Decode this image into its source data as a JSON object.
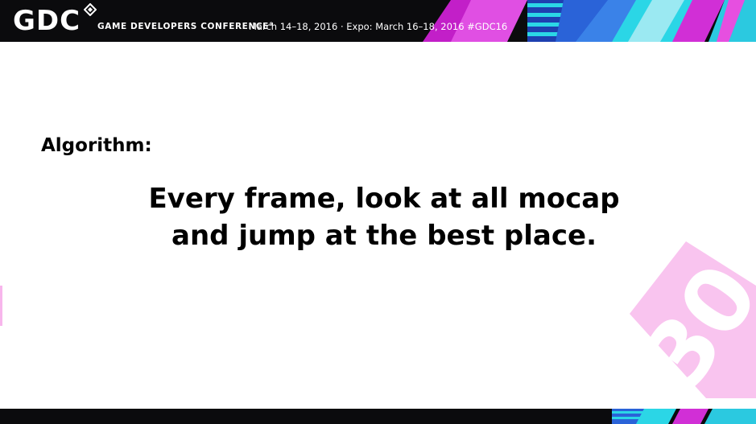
{
  "header": {
    "logo_text": "GDC",
    "conference_name": "GAME DEVELOPERS CONFERENCE",
    "trademark": "®",
    "dates": "March 14–18, 2016 · Expo: March 16–18, 2016  #GDC16"
  },
  "slide": {
    "label": "Algorithm:",
    "statement_lines": [
      "Every frame, look at all mocap",
      "and jump at the best place."
    ]
  },
  "watermark_text": "30",
  "colors": {
    "header_bg": "#0b0b0d",
    "accent_magenta": "#d12fd6",
    "accent_cyan": "#2bd6e6",
    "accent_blue": "#2a63d8",
    "watermark_pink": "#f7b6ec",
    "text": "#000000"
  }
}
